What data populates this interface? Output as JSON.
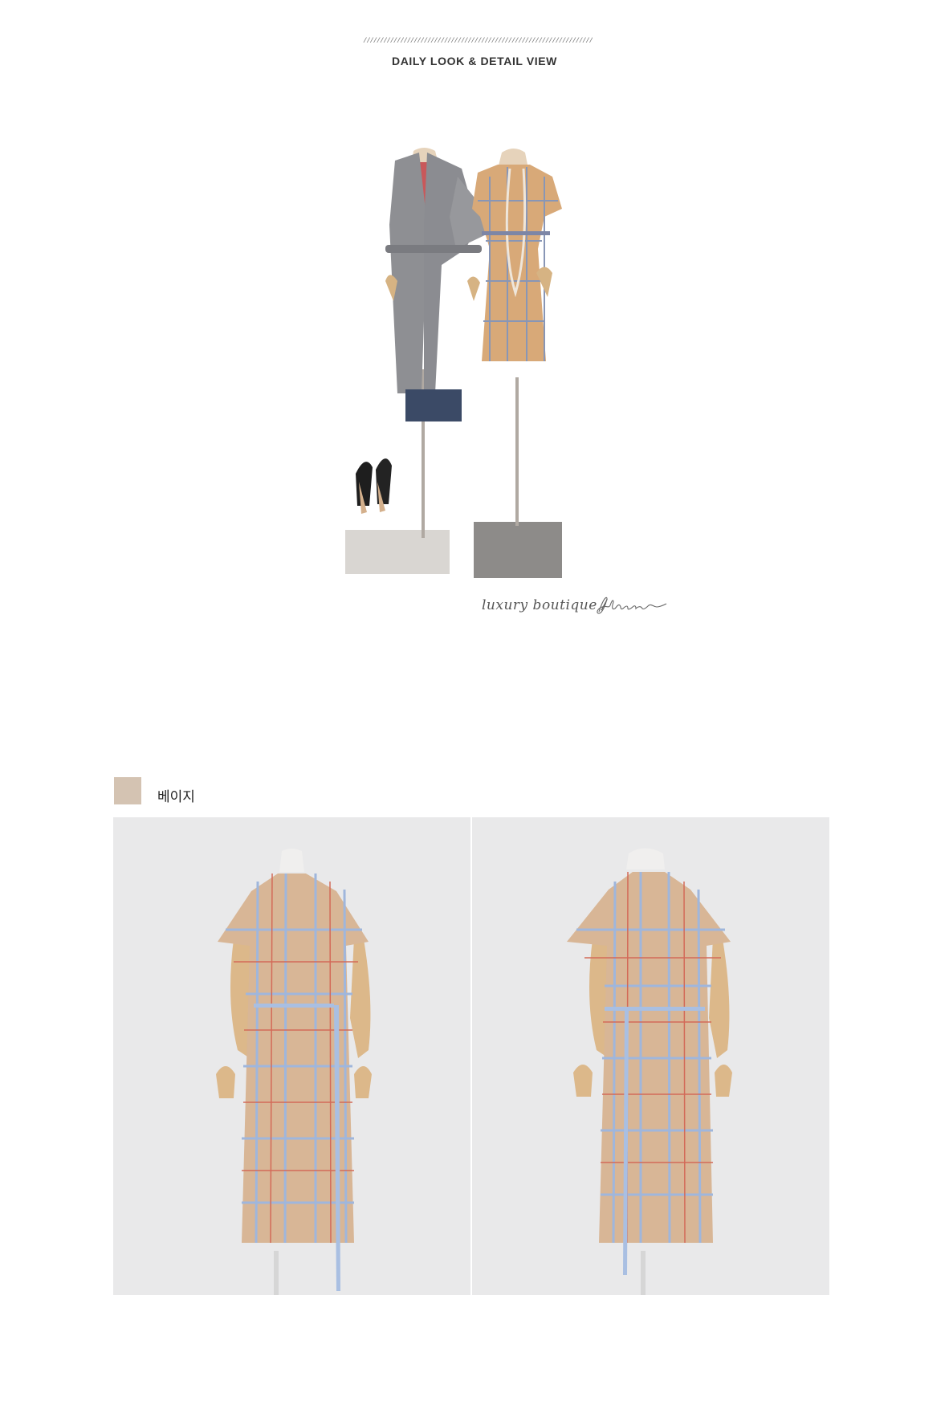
{
  "header": {
    "decoration": "////////////////////////////////////////////////////////////////////////////////",
    "title": "DAILY LOOK & DETAIL VIEW"
  },
  "hero": {
    "brand_text": "luxury boutique",
    "brand_separator": "/",
    "signature_text": "Jblanc"
  },
  "color_option": {
    "swatch_color": "#d4c3b2",
    "name": "베이지"
  },
  "colors": {
    "dress_base": "#d8b696",
    "check_blue": "#9fb6dc",
    "check_red": "#d36a58",
    "coat_grey": "#8e8f93",
    "background": "#e9e9ea"
  }
}
